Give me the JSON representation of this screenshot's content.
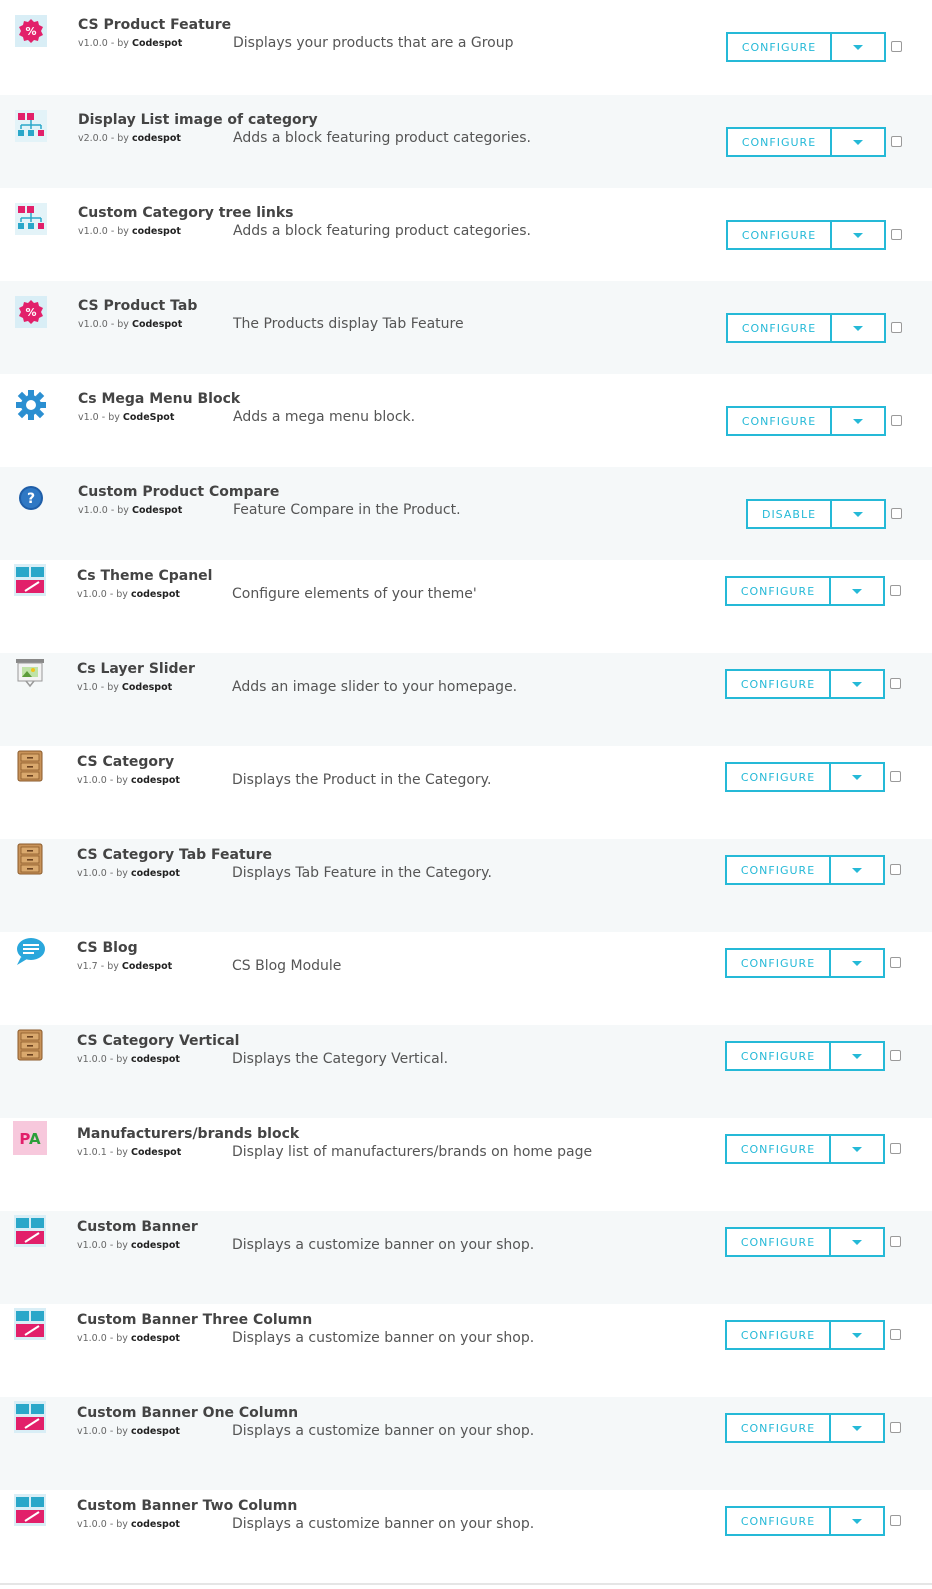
{
  "colors": {
    "accent": "#25b9d7",
    "row_alt": "#f5f8f9"
  },
  "version_separator": "- by",
  "modules": [
    {
      "name": "CS Product Feature",
      "version": "v1.0.0",
      "author": "Codespot",
      "description": "Displays your products that are a Group",
      "action": "CONFIGURE",
      "icon": "discount-badge-icon"
    },
    {
      "name": "Display List image of category",
      "version": "v2.0.0",
      "author": "codespot",
      "description": "Adds a block featuring product categories.",
      "action": "CONFIGURE",
      "icon": "category-tree-icon"
    },
    {
      "name": "Custom Category tree links",
      "version": "v1.0.0",
      "author": "codespot",
      "description": "Adds a block featuring product categories.",
      "action": "CONFIGURE",
      "icon": "category-tree-icon"
    },
    {
      "name": "CS Product Tab",
      "version": "v1.0.0",
      "author": "Codespot",
      "description": "The Products display Tab Feature",
      "action": "CONFIGURE",
      "icon": "discount-badge-icon"
    },
    {
      "name": "Cs Mega Menu Block",
      "version": "v1.0",
      "author": "CodeSpot",
      "description": "Adds a mega menu block.",
      "action": "CONFIGURE",
      "icon": "gear-icon"
    },
    {
      "name": "Custom Product Compare",
      "version": "v1.0.0",
      "author": "Codespot",
      "description": "Feature Compare in the Product.",
      "action": "DISABLE",
      "icon": "question-icon"
    },
    {
      "name": "Cs Theme Cpanel",
      "version": "v1.0.0",
      "author": "codespot",
      "description": "Configure elements of your theme'",
      "action": "CONFIGURE",
      "icon": "banner-icon"
    },
    {
      "name": "Cs Layer Slider",
      "version": "v1.0",
      "author": "Codespot",
      "description": "Adds an image slider to your homepage.",
      "action": "CONFIGURE",
      "icon": "slider-easel-icon"
    },
    {
      "name": "CS Category",
      "version": "v1.0.0",
      "author": "codespot",
      "description": "Displays the Product in the Category.",
      "action": "CONFIGURE",
      "icon": "cabinet-icon"
    },
    {
      "name": "CS Category Tab Feature",
      "version": "v1.0.0",
      "author": "codespot",
      "description": "Displays Tab Feature in the Category.",
      "action": "CONFIGURE",
      "icon": "cabinet-icon"
    },
    {
      "name": "CS Blog",
      "version": "v1.7",
      "author": "Codespot",
      "description": "CS Blog Module",
      "action": "CONFIGURE",
      "icon": "speech-bubble-icon"
    },
    {
      "name": "CS Category Vertical",
      "version": "v1.0.0",
      "author": "codespot",
      "description": "Displays the Category Vertical.",
      "action": "CONFIGURE",
      "icon": "cabinet-icon"
    },
    {
      "name": "Manufacturers/brands block",
      "version": "v1.0.1",
      "author": "Codespot",
      "description": "Display list of manufacturers/brands on home page",
      "action": "CONFIGURE",
      "icon": "pa-logo-icon",
      "icon_text": "PA"
    },
    {
      "name": "Custom Banner",
      "version": "v1.0.0",
      "author": "codespot",
      "description": "Displays a customize banner on your shop.",
      "action": "CONFIGURE",
      "icon": "banner-icon"
    },
    {
      "name": "Custom Banner Three Column",
      "version": "v1.0.0",
      "author": "codespot",
      "description": "Displays a customize banner on your shop.",
      "action": "CONFIGURE",
      "icon": "banner-icon"
    },
    {
      "name": "Custom Banner One Column",
      "version": "v1.0.0",
      "author": "codespot",
      "description": "Displays a customize banner on your shop.",
      "action": "CONFIGURE",
      "icon": "banner-icon"
    },
    {
      "name": "Custom Banner Two Column",
      "version": "v1.0.0",
      "author": "codespot",
      "description": "Displays a customize banner on your shop.",
      "action": "CONFIGURE",
      "icon": "banner-icon"
    }
  ]
}
